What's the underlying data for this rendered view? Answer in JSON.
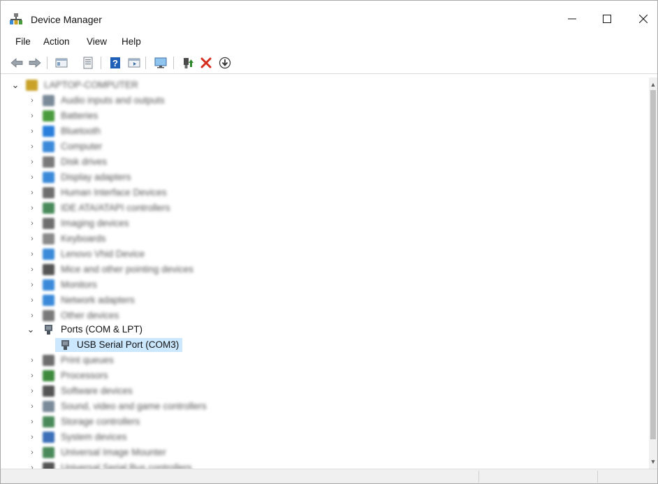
{
  "window": {
    "title": "Device Manager",
    "controls": {
      "minimize": "—",
      "maximize": "☐",
      "close": "✕"
    }
  },
  "menubar": {
    "items": [
      "File",
      "Action",
      "View",
      "Help"
    ]
  },
  "toolbar": {
    "icons": [
      "back-arrow-icon",
      "forward-arrow-icon",
      "properties-grid-icon",
      "properties-sheet-icon",
      "help-icon",
      "run-view-icon",
      "monitor-icon",
      "update-driver-icon",
      "uninstall-x-icon",
      "download-circle-icon"
    ],
    "colors": {
      "uninstall": "#d62c1e",
      "help": "#1f5fb8",
      "update": "#2f8a2f"
    }
  },
  "tree": {
    "computer_name": "LAPTOP-COMPUTER",
    "categories": [
      {
        "label": "Audio inputs and outputs",
        "icon": "speaker-icon",
        "color": "#7a8a98"
      },
      {
        "label": "Batteries",
        "icon": "battery-icon",
        "color": "#4a9b3e"
      },
      {
        "label": "Bluetooth",
        "icon": "bluetooth-icon",
        "color": "#2a7fdc"
      },
      {
        "label": "Computer",
        "icon": "computer-icon",
        "color": "#3b8ad9"
      },
      {
        "label": "Disk drives",
        "icon": "disk-drive-icon",
        "color": "#7a7a7a"
      },
      {
        "label": "Display adapters",
        "icon": "display-adapter-icon",
        "color": "#3b8ad9"
      },
      {
        "label": "Human Interface Devices",
        "icon": "hid-icon",
        "color": "#6e6e6e"
      },
      {
        "label": "IDE ATA/ATAPI controllers",
        "icon": "ide-controller-icon",
        "color": "#4a8a5a"
      },
      {
        "label": "Imaging devices",
        "icon": "camera-icon",
        "color": "#6e6e6e"
      },
      {
        "label": "Keyboards",
        "icon": "keyboard-icon",
        "color": "#8a8a8a"
      },
      {
        "label": "Lenovo Vhid Device",
        "icon": "vhid-icon",
        "color": "#3b8ad9"
      },
      {
        "label": "Mice and other pointing devices",
        "icon": "mouse-icon",
        "color": "#555555"
      },
      {
        "label": "Monitors",
        "icon": "monitor-icon",
        "color": "#3b8ad9"
      },
      {
        "label": "Network adapters",
        "icon": "network-icon",
        "color": "#3b8ad9"
      },
      {
        "label": "Other devices",
        "icon": "other-device-icon",
        "color": "#7a7a7a"
      }
    ],
    "ports": {
      "label": "Ports (COM & LPT)",
      "child": "USB Serial Port (COM3)"
    },
    "categories_after": [
      {
        "label": "Print queues",
        "icon": "printer-icon",
        "color": "#6e6e6e"
      },
      {
        "label": "Processors",
        "icon": "processor-icon",
        "color": "#3d8a3d"
      },
      {
        "label": "Software devices",
        "icon": "software-device-icon",
        "color": "#555555"
      },
      {
        "label": "Sound, video and game controllers",
        "icon": "sound-icon",
        "color": "#7a8a98"
      },
      {
        "label": "Storage controllers",
        "icon": "storage-icon",
        "color": "#4a8a5a"
      },
      {
        "label": "System devices",
        "icon": "system-device-icon",
        "color": "#3b6fb8"
      },
      {
        "label": "Universal Image Mounter",
        "icon": "image-mounter-icon",
        "color": "#4a8a5a"
      },
      {
        "label": "Universal Serial Bus controllers",
        "icon": "usb-icon",
        "color": "#555555"
      }
    ]
  }
}
